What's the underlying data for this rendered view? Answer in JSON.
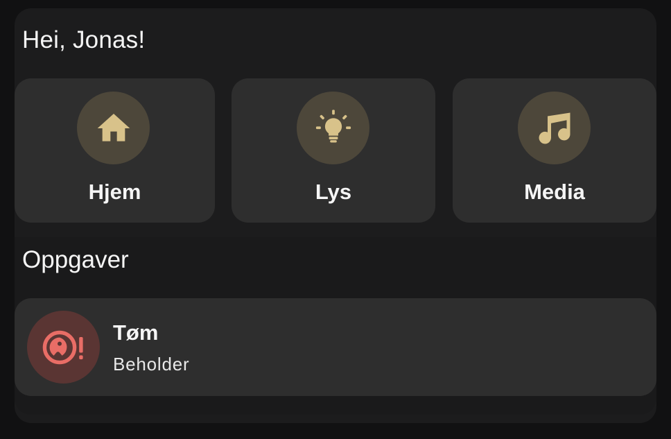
{
  "greeting": "Hei, Jonas!",
  "tiles": [
    {
      "label": "Hjem",
      "icon": "home-icon"
    },
    {
      "label": "Lys",
      "icon": "lightbulb-icon"
    },
    {
      "label": "Media",
      "icon": "music-note-icon"
    }
  ],
  "tasks_section": {
    "title": "Oppgaver",
    "items": [
      {
        "title": "Tøm",
        "subtitle": "Beholder",
        "icon": "robot-vacuum-alert-icon"
      }
    ]
  },
  "colors": {
    "accent": "#d8c28a",
    "alert": "#e96d66",
    "tile_bg": "#2e2e2e",
    "panel_bg": "#1c1c1d",
    "icon_circle": "#4d473a",
    "alert_circle": "#5a3533"
  }
}
